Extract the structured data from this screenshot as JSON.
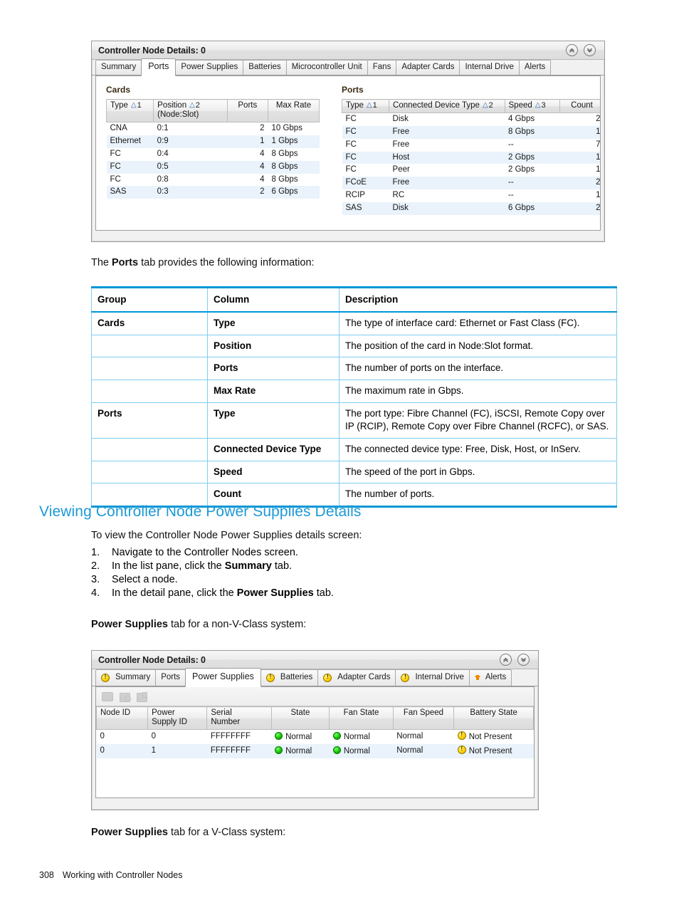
{
  "panel_ports": {
    "title": "Controller Node Details: 0",
    "window_buttons": [
      {
        "name": "collapse-all",
        "glyph": "«"
      },
      {
        "name": "expand-all",
        "glyph": "»"
      }
    ],
    "tabs": [
      {
        "label": "Summary",
        "active": false
      },
      {
        "label": "Ports",
        "active": true
      },
      {
        "label": "Power Supplies",
        "active": false
      },
      {
        "label": "Batteries",
        "active": false
      },
      {
        "label": "Microcontroller Unit",
        "active": false
      },
      {
        "label": "Fans",
        "active": false
      },
      {
        "label": "Adapter Cards",
        "active": false
      },
      {
        "label": "Internal Drive",
        "active": false
      },
      {
        "label": "Alerts",
        "active": false
      }
    ],
    "cards": {
      "group_label": "Cards",
      "columns": [
        {
          "label": "Type",
          "sort": "1"
        },
        {
          "label": "Position",
          "label2": "(Node:Slot)",
          "sort": "2"
        },
        {
          "label": "Ports",
          "sort": ""
        },
        {
          "label": "Max Rate",
          "sort": ""
        }
      ],
      "rows": [
        {
          "type": "CNA",
          "position": "0:1",
          "ports": "2",
          "max_rate": "10 Gbps"
        },
        {
          "type": "Ethernet",
          "position": "0:9",
          "ports": "1",
          "max_rate": "1 Gbps"
        },
        {
          "type": "FC",
          "position": "0:4",
          "ports": "4",
          "max_rate": "8 Gbps"
        },
        {
          "type": "FC",
          "position": "0:5",
          "ports": "4",
          "max_rate": "8 Gbps"
        },
        {
          "type": "FC",
          "position": "0:8",
          "ports": "4",
          "max_rate": "8 Gbps"
        },
        {
          "type": "SAS",
          "position": "0:3",
          "ports": "2",
          "max_rate": "6 Gbps"
        }
      ]
    },
    "ports": {
      "group_label": "Ports",
      "columns": [
        {
          "label": "Type",
          "sort": "1"
        },
        {
          "label": "Connected Device Type",
          "sort": "2"
        },
        {
          "label": "Speed",
          "sort": "3"
        },
        {
          "label": "Count",
          "sort": ""
        }
      ],
      "rows": [
        {
          "type": "FC",
          "device": "Disk",
          "speed": "4 Gbps",
          "count": "2"
        },
        {
          "type": "FC",
          "device": "Free",
          "speed": "8 Gbps",
          "count": "1"
        },
        {
          "type": "FC",
          "device": "Free",
          "speed": "--",
          "count": "7"
        },
        {
          "type": "FC",
          "device": "Host",
          "speed": "2 Gbps",
          "count": "1"
        },
        {
          "type": "FC",
          "device": "Peer",
          "speed": "2 Gbps",
          "count": "1"
        },
        {
          "type": "FCoE",
          "device": "Free",
          "speed": "--",
          "count": "2"
        },
        {
          "type": "RCIP",
          "device": "RC",
          "speed": "--",
          "count": "1"
        },
        {
          "type": "SAS",
          "device": "Disk",
          "speed": "6 Gbps",
          "count": "2"
        }
      ]
    }
  },
  "para_ports": {
    "pre": "The ",
    "bold": "Ports",
    "post": " tab provides the following information:"
  },
  "desc_table": {
    "headers": {
      "group": "Group",
      "column": "Column",
      "description": "Description"
    },
    "rows": [
      {
        "group": "Cards",
        "column": "Type",
        "description": "The type of interface card: Ethernet or Fast Class (FC)."
      },
      {
        "group": "",
        "column": "Position",
        "description": "The position of the card in Node:Slot format."
      },
      {
        "group": "",
        "column": "Ports",
        "description": "The number of ports on the interface."
      },
      {
        "group": "",
        "column": "Max Rate",
        "description": "The maximum rate in Gbps."
      },
      {
        "group": "Ports",
        "column": "Type",
        "description": "The port type: Fibre Channel (FC), iSCSI, Remote Copy over IP (RCIP), Remote Copy over Fibre Channel (RCFC), or SAS."
      },
      {
        "group": "",
        "column": "Connected Device Type",
        "description": "The connected device type: Free, Disk, Host, or InServ."
      },
      {
        "group": "",
        "column": "Speed",
        "description": "The speed of the port in Gbps."
      },
      {
        "group": "",
        "column": "Count",
        "description": "The number of ports."
      }
    ]
  },
  "section": {
    "heading": "Viewing Controller Node Power Supplies Details",
    "intro": "To view the Controller Node Power Supplies details screen:",
    "steps": [
      {
        "num": "1.",
        "pre": "Navigate to the Controller Nodes screen.",
        "bold": "",
        "post": ""
      },
      {
        "num": "2.",
        "pre": "In the list pane, click the ",
        "bold": "Summary",
        "post": " tab."
      },
      {
        "num": "3.",
        "pre": "Select a node.",
        "bold": "",
        "post": ""
      },
      {
        "num": "4.",
        "pre": "In the detail pane, click the ",
        "bold": "Power Supplies",
        "post": " tab."
      }
    ],
    "nonv_line": {
      "bold": "Power Supplies",
      "post": " tab for a non-V-Class system:"
    },
    "vclass_line": {
      "bold": "Power Supplies",
      "post": " tab for a V-Class system:"
    }
  },
  "panel_ps": {
    "title": "Controller Node Details: 0",
    "window_buttons": [
      {
        "name": "collapse-all",
        "glyph": "«"
      },
      {
        "name": "expand-all",
        "glyph": "»"
      }
    ],
    "tabs": [
      {
        "label": "Summary",
        "icon": "warning-icon",
        "active": false
      },
      {
        "label": "Ports",
        "icon": "",
        "active": false
      },
      {
        "label": "Power Supplies",
        "icon": "",
        "active": true
      },
      {
        "label": "Batteries",
        "icon": "warning-icon",
        "active": false
      },
      {
        "label": "Adapter Cards",
        "icon": "warning-icon",
        "active": false
      },
      {
        "label": "Internal Drive",
        "icon": "warning-icon",
        "active": false
      },
      {
        "label": "Alerts",
        "icon": "alert-arrow-icon",
        "active": false
      }
    ],
    "toolbar_icons": [
      "edit-icon",
      "chart-search-icon",
      "chart-icon"
    ],
    "columns": [
      {
        "label": "Node ID",
        "label2": ""
      },
      {
        "label": "Power",
        "label2": "Supply ID"
      },
      {
        "label": "Serial",
        "label2": "Number"
      },
      {
        "label": "State",
        "label2": ""
      },
      {
        "label": "Fan State",
        "label2": ""
      },
      {
        "label": "Fan Speed",
        "label2": ""
      },
      {
        "label": "Battery State",
        "label2": ""
      }
    ],
    "rows": [
      {
        "node_id": "0",
        "ps_id": "0",
        "serial": "FFFFFFFF",
        "state": "Normal",
        "state_icon": "green-dot",
        "fan_state": "Normal",
        "fan_state_icon": "green-dot",
        "fan_speed": "Normal",
        "battery_state": "Not Present",
        "battery_icon": "warning-icon"
      },
      {
        "node_id": "0",
        "ps_id": "1",
        "serial": "FFFFFFFF",
        "state": "Normal",
        "state_icon": "green-dot",
        "fan_state": "Normal",
        "fan_state_icon": "green-dot",
        "fan_speed": "Normal",
        "battery_state": "Not Present",
        "battery_icon": "warning-icon"
      }
    ]
  },
  "footer": {
    "page_number": "308",
    "chapter": "Working with Controller Nodes"
  },
  "colors": {
    "heading_blue": "#1b9ad6",
    "table_border_blue": "#0096d6",
    "table_grid_blue": "#7ecdf0",
    "row_alt": "#eaf3fb",
    "status_green": "#13c400",
    "status_yellow": "#ffd200",
    "alert_orange": "#f08a00"
  }
}
